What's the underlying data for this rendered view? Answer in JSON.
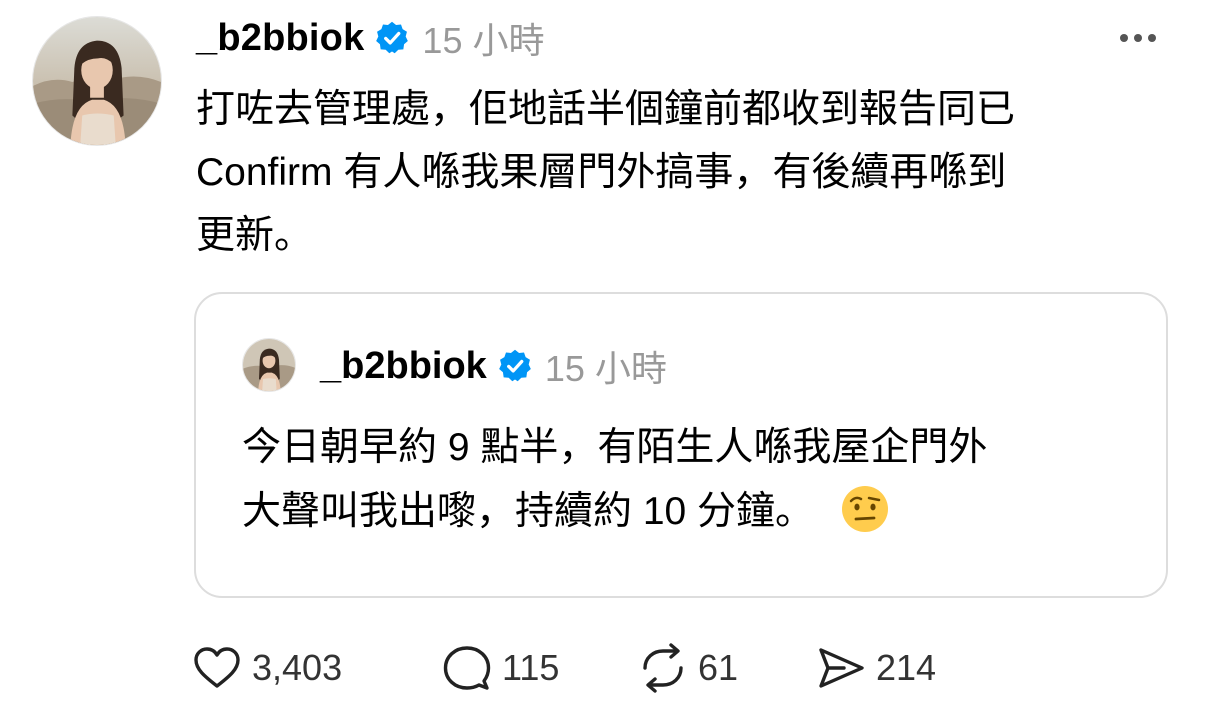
{
  "post": {
    "username": "_b2bbiok",
    "time": "15 小時",
    "text_line1": "打咗去管理處，佢地話半個鐘前都收到報告同已",
    "text_line2": "Confirm 有人喺我果層門外搞事，有後續再喺到",
    "text_line3": "更新。",
    "verified_icon": "verified-badge-icon",
    "more_icon": "more-dots-icon"
  },
  "quote": {
    "username": "_b2bbiok",
    "time": "15 小時",
    "text_line1": "今日朝早約 9 點半，有陌生人喺我屋企門外",
    "text_line2": "大聲叫我出嚟，持續約 10 分鐘。",
    "emoji": "face-with-raised-eyebrow-emoji"
  },
  "actions": {
    "likes": "3,403",
    "replies": "115",
    "reposts": "61",
    "shares": "214"
  },
  "colors": {
    "verified": "#0095f6",
    "muted": "#999999",
    "border": "#dddddd"
  }
}
